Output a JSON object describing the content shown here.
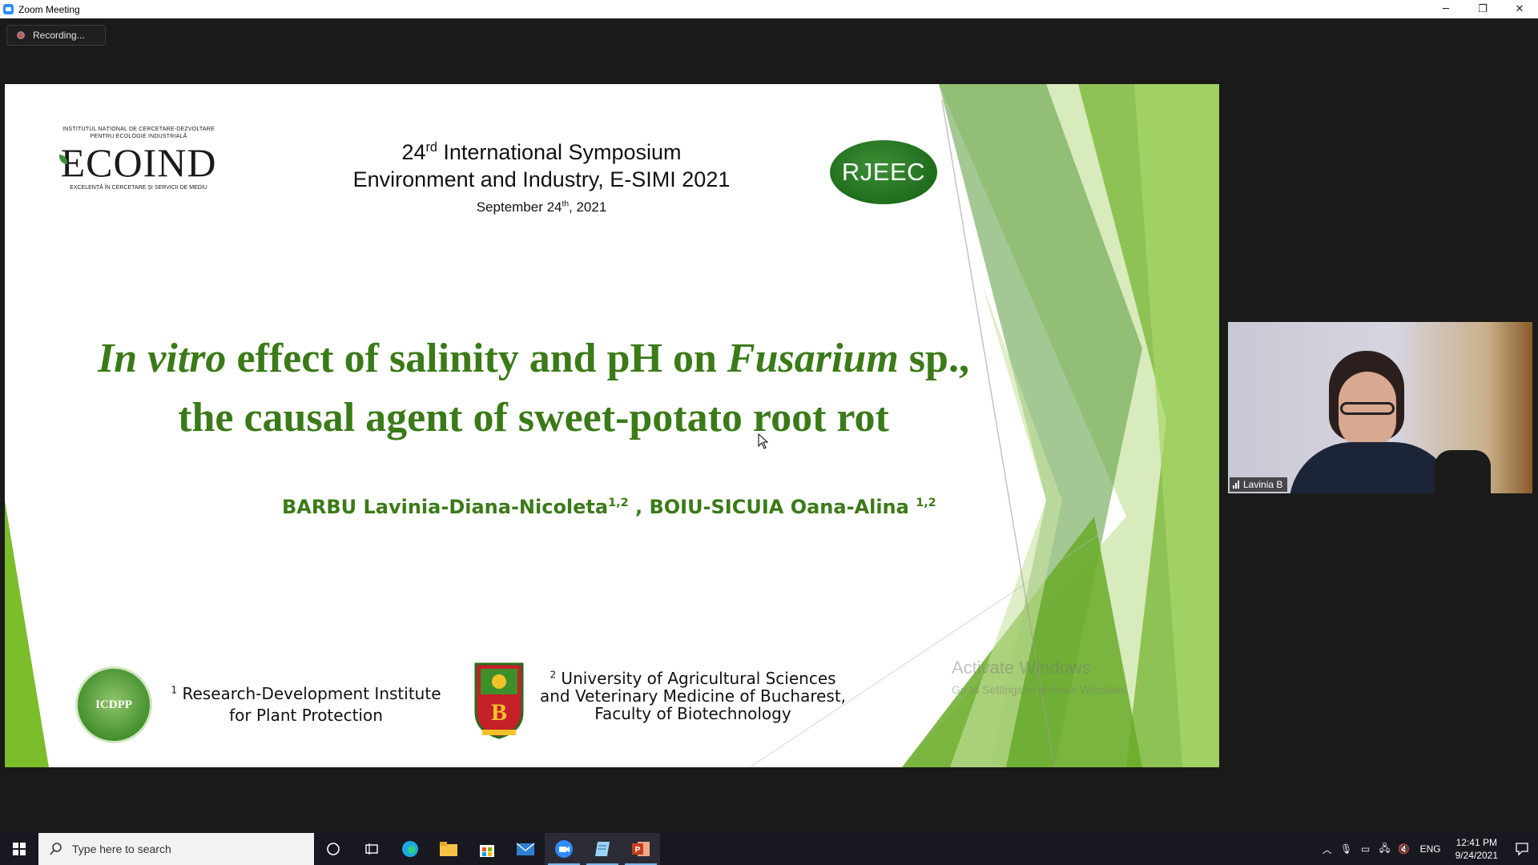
{
  "window": {
    "title": "Zoom Meeting",
    "controls": {
      "minimize": "─",
      "restore": "❐",
      "close": "✕"
    }
  },
  "recording": {
    "label": "Recording..."
  },
  "slide": {
    "ecoind": {
      "top_line_1": "INSTITUTUL NAȚIONAL DE CERCETARE-DEZVOLTARE",
      "top_line_2": "PENTRU ECOLOGIE INDUSTRIALĂ",
      "brand": "ECOIND",
      "tagline": "EXCELENȚĂ ÎN CERCETARE ȘI SERVICII DE MEDIU"
    },
    "symposium": {
      "ordinal_num": "24",
      "ordinal_sup": "rd",
      "line1_rest": " International Symposium",
      "line2": "Environment and Industry, E-SIMI 2021",
      "date_pre": "September 24",
      "date_sup": "th",
      "date_post": ", 2021"
    },
    "rjeec_logo": "RJEEC",
    "title": {
      "part1_italic": "In vitro",
      "part2": " effect of salinity and pH on ",
      "part3_italic": "Fusarium",
      "part4": " sp.,",
      "line2": "the causal agent of sweet-potato root rot"
    },
    "authors": {
      "author1": "BARBU Lavinia-Diana-Nicoleta",
      "author1_sup": "1,2",
      "separator": " , ",
      "author2": "BOIU-SICUIA Oana-Alina ",
      "author2_sup": "1,2"
    },
    "affiliation1": {
      "logo_text": "ICDPP",
      "sup": "1",
      "line1": "Research-Development Institute",
      "line2": "for Plant Protection"
    },
    "affiliation2": {
      "sup": "2",
      "line1": " University of Agricultural Sciences",
      "line2": "and Veterinary Medicine of Bucharest,",
      "line3": "Faculty of Biotechnology"
    },
    "watermark": {
      "line1": "Activate Windows",
      "line2": "Go to Settings to activate Windows."
    }
  },
  "participant": {
    "name": "Lavinia B"
  },
  "taskbar": {
    "search_placeholder": "Type here to search",
    "language": "ENG",
    "time": "12:41 PM",
    "date": "9/24/2021"
  },
  "colors": {
    "title_green": "#3a7a18",
    "slide_bg": "#ffffff",
    "zoom_bg": "#1a1a1a",
    "taskbar_bg": "#181820"
  }
}
